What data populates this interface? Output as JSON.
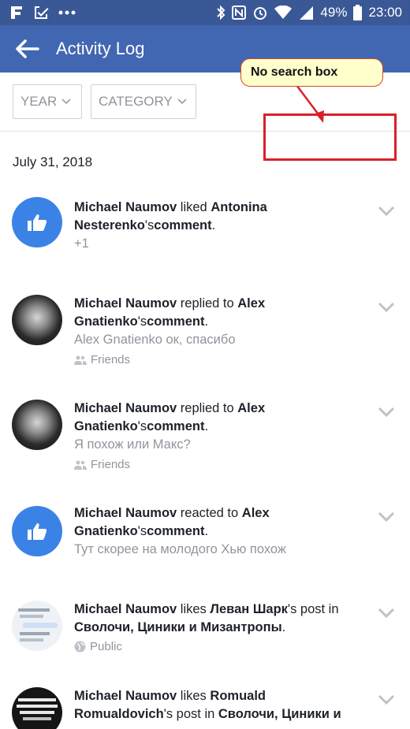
{
  "status_bar": {
    "battery": "49%",
    "time": "23:00"
  },
  "header": {
    "title": "Activity Log"
  },
  "filters": {
    "year_label": "YEAR",
    "category_label": "CATEGORY"
  },
  "annotation": {
    "callout_text": "No search box"
  },
  "date_header": "July 31, 2018",
  "items": [
    {
      "actor": "Michael Naumov",
      "verb": " liked ",
      "target": "Antonina Nesterenko",
      "poss": "'s",
      "object": "comment",
      "end": ".",
      "sub": "+1",
      "audience": ""
    },
    {
      "actor": "Michael Naumov",
      "verb": " replied to ",
      "target": "Alex Gnatienko",
      "poss": "'s",
      "object": "comment",
      "end": ".",
      "sub": "Alex Gnatienko ок, спасибо",
      "audience": "Friends"
    },
    {
      "actor": "Michael Naumov",
      "verb": " replied to ",
      "target": "Alex Gnatienko",
      "poss": "'s",
      "object": "comment",
      "end": ".",
      "sub": "Я похож или Макс?",
      "audience": "Friends"
    },
    {
      "actor": "Michael Naumov",
      "verb": " reacted to ",
      "target": "Alex Gnatienko",
      "poss": "'s",
      "object": "comment",
      "end": ".",
      "sub": "Тут скорее на молодого Хью похож",
      "audience": ""
    },
    {
      "actor": "Michael Naumov",
      "verb": " likes ",
      "target": "Леван Шарк",
      "poss": "'s post in ",
      "object": "Сволочи, Циники и Мизантропы",
      "end": ".",
      "sub": "",
      "audience": "Public"
    },
    {
      "actor": "Michael Naumov",
      "verb": " likes ",
      "target": "Romuald Romualdovich",
      "poss": "'s post in ",
      "object": "Сволочи, Циники и",
      "end": "",
      "sub": "",
      "audience": ""
    }
  ]
}
